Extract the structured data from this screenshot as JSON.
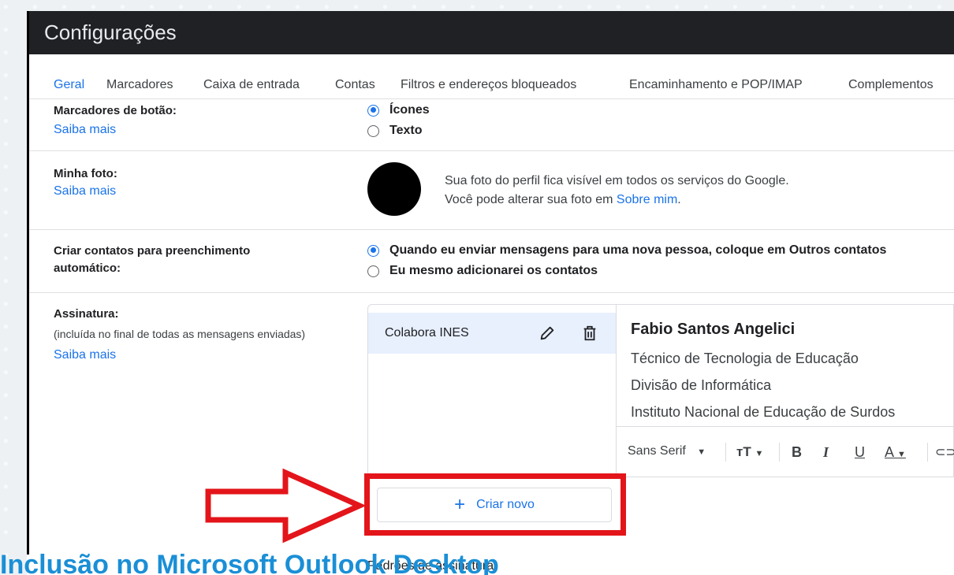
{
  "window": {
    "title": "Configurações"
  },
  "tabs": [
    {
      "label": "Geral",
      "active": true
    },
    {
      "label": "Marcadores"
    },
    {
      "label": "Caixa de entrada"
    },
    {
      "label": "Contas"
    },
    {
      "label": "Filtros e endereços bloqueados"
    },
    {
      "label": "Encaminhamento e POP/IMAP"
    },
    {
      "label": "Complementos"
    }
  ],
  "button_labels": {
    "label": "Marcadores de botão:",
    "learn_more": "Saiba mais",
    "options": [
      "Ícones",
      "Texto"
    ],
    "selected": "Ícones"
  },
  "my_photo": {
    "label": "Minha foto:",
    "learn_more": "Saiba mais",
    "text_line1": "Sua foto do perfil fica visível em todos os serviços do Google.",
    "text_line2_prefix": "Você pode alterar sua foto em ",
    "text_line2_link": "Sobre mim",
    "text_line2_suffix": "."
  },
  "auto_contacts": {
    "label_line1": "Criar contatos para preenchimento",
    "label_line2": "automático:",
    "options": [
      "Quando eu enviar mensagens para uma nova pessoa, coloque em Outros contatos",
      "Eu mesmo adicionarei os contatos"
    ]
  },
  "signature": {
    "label": "Assinatura:",
    "sublabel": "(incluída no final de todas as mensagens enviadas)",
    "learn_more": "Saiba mais",
    "items": [
      {
        "name": "Colabora INES"
      }
    ],
    "editor": {
      "name": "Fabio Santos Angelici",
      "lines": [
        "Técnico de Tecnologia de Educação",
        "Divisão de Informática",
        "Instituto Nacional de Educação de Surdos"
      ]
    },
    "toolbar": {
      "font": "Sans Serif",
      "bold": "B",
      "italic": "I",
      "underline": "U",
      "color": "A"
    },
    "create_new": "Criar novo",
    "defaults": "Padrões de assinatura"
  },
  "caption": "Inclusão no Microsoft Outlook Desktop",
  "colors": {
    "accent": "#1a73e8",
    "highlight": "#e3151a",
    "caption": "#1a8fd6"
  }
}
